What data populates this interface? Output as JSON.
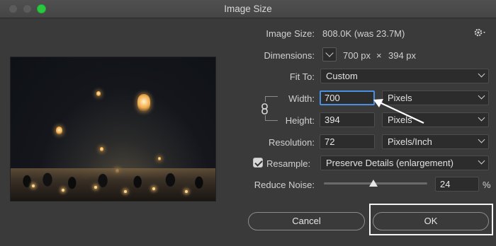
{
  "window": {
    "title": "Image Size"
  },
  "image_size": {
    "label": "Image Size:",
    "value": "808.0K (was 23.7M)"
  },
  "dimensions": {
    "label": "Dimensions:",
    "width": "700 px",
    "times": "×",
    "height": "394 px"
  },
  "fit_to": {
    "label": "Fit To:",
    "value": "Custom"
  },
  "width": {
    "label": "Width:",
    "value": "700",
    "unit": "Pixels"
  },
  "height": {
    "label": "Height:",
    "value": "394",
    "unit": "Pixels"
  },
  "resolution": {
    "label": "Resolution:",
    "value": "72",
    "unit": "Pixels/Inch"
  },
  "resample": {
    "label": "Resample:",
    "checked": true,
    "value": "Preserve Details (enlargement)"
  },
  "reduce_noise": {
    "label": "Reduce Noise:",
    "value": "24",
    "unit": "%",
    "level_fraction": 0.24
  },
  "buttons": {
    "cancel": "Cancel",
    "ok": "OK"
  },
  "icons": {
    "settings": "gear-icon",
    "link": "chain-link-icon",
    "dropdown": "chevron-down-icon"
  },
  "colors": {
    "active_field_border": "#4a8fe0",
    "zoom_button": "#2ac840"
  }
}
